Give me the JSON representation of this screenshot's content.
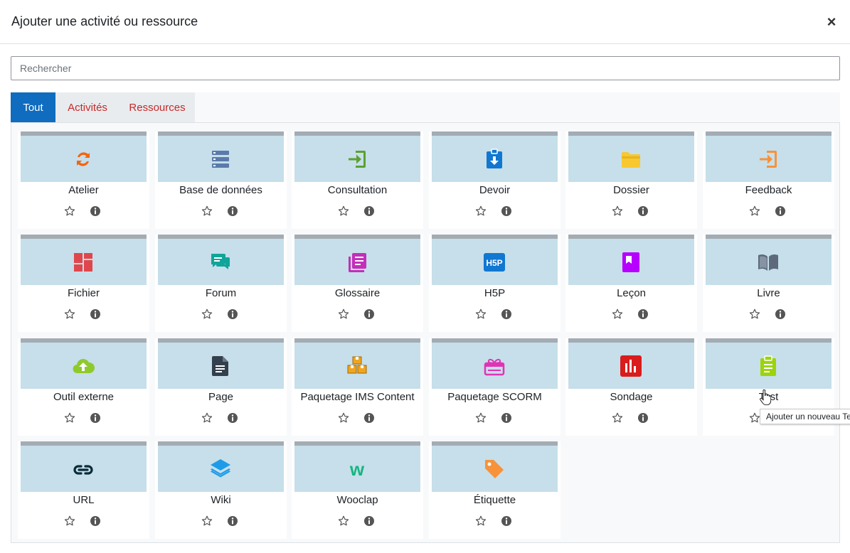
{
  "modal": {
    "title": "Ajouter une activité ou ressource",
    "close_label": "×"
  },
  "search": {
    "placeholder": "Rechercher",
    "value": ""
  },
  "tabs": [
    {
      "label": "Tout",
      "active": true
    },
    {
      "label": "Activités",
      "active": false
    },
    {
      "label": "Ressources",
      "active": false
    }
  ],
  "colors": {
    "accent": "#0f6cbf",
    "tab_link": "#c52a2a",
    "card_top": "#c6dfea",
    "card_top_border": "#a4acb3"
  },
  "modules": [
    {
      "name": "Atelier",
      "icon": "refresh-icon",
      "color": "#f7630c"
    },
    {
      "name": "Base de données",
      "icon": "database-icon",
      "color": "#5b7bab"
    },
    {
      "name": "Consultation",
      "icon": "sign-in-icon",
      "color": "#5da130"
    },
    {
      "name": "Devoir",
      "icon": "clipboard-download-icon",
      "color": "#1177d1"
    },
    {
      "name": "Dossier",
      "icon": "folder-icon",
      "color": "#f7c830"
    },
    {
      "name": "Feedback",
      "icon": "sign-in-icon",
      "color": "#f7923a"
    },
    {
      "name": "Fichier",
      "icon": "file-dashboard-icon",
      "color": "#e0474c"
    },
    {
      "name": "Forum",
      "icon": "comments-icon",
      "color": "#11a59a"
    },
    {
      "name": "Glossaire",
      "icon": "glossary-icon",
      "color": "#c32fb9"
    },
    {
      "name": "H5P",
      "icon": "h5p-icon",
      "color": "#1177d1"
    },
    {
      "name": "Leçon",
      "icon": "lesson-book-icon",
      "color": "#b700ff"
    },
    {
      "name": "Livre",
      "icon": "book-open-icon",
      "color": "#5c6a7c"
    },
    {
      "name": "Outil externe",
      "icon": "cloud-upload-icon",
      "color": "#8fca2d"
    },
    {
      "name": "Page",
      "icon": "file-text-icon",
      "color": "#333f4c"
    },
    {
      "name": "Paquetage IMS Content",
      "icon": "boxes-icon",
      "color": "#f0a51e"
    },
    {
      "name": "Paquetage SCORM",
      "icon": "package-icon",
      "color": "#e133b5"
    },
    {
      "name": "Sondage",
      "icon": "bar-chart-icon",
      "color": "#d91c1c"
    },
    {
      "name": "Test",
      "icon": "quiz-clipboard-icon",
      "color": "#9bd40c"
    },
    {
      "name": "URL",
      "icon": "link-icon",
      "color": "#0b2a3a"
    },
    {
      "name": "Wiki",
      "icon": "layers-icon",
      "color": "#1e9be8"
    },
    {
      "name": "Wooclap",
      "icon": "wooclap-icon",
      "color": "#17b582"
    },
    {
      "name": "Étiquette",
      "icon": "tag-icon",
      "color": "#f7923a"
    }
  ],
  "card_actions": {
    "star_icon": "star-icon",
    "info_icon": "info-icon"
  },
  "tooltip": {
    "text": "Ajouter un nouveau Test"
  }
}
